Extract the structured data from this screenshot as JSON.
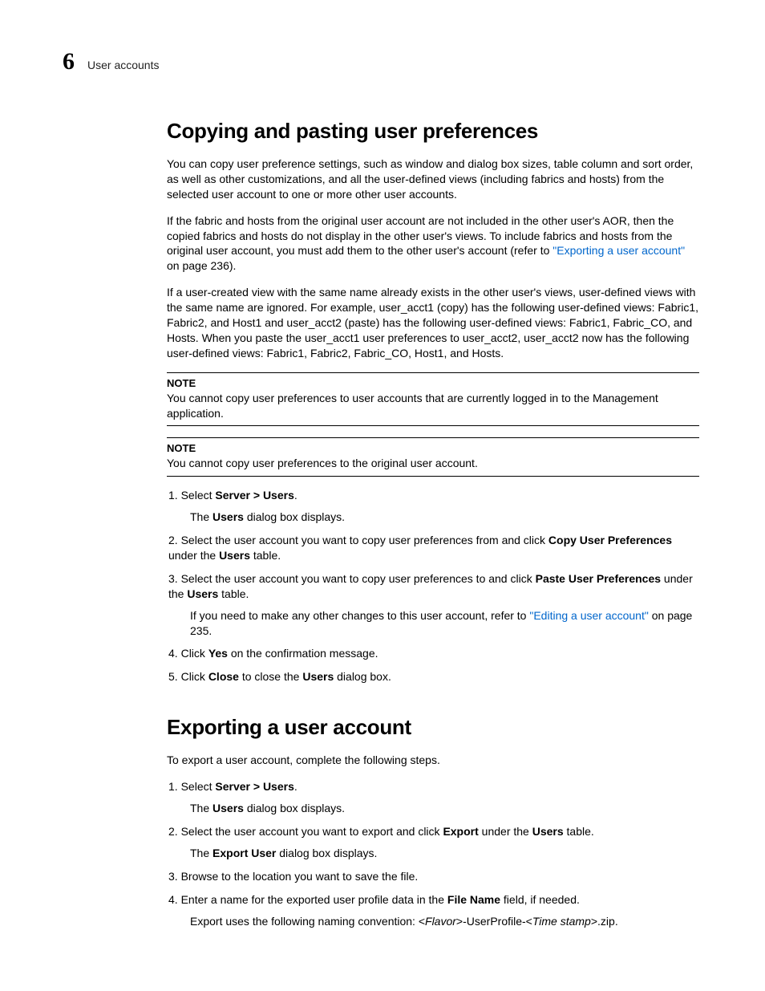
{
  "header": {
    "chapter_num": "6",
    "running_title": "User accounts"
  },
  "section1": {
    "title": "Copying and pasting user preferences",
    "p1": "You can copy user preference settings, such as window and dialog box sizes, table column and sort order, as well as other customizations, and all the user-defined views (including fabrics and hosts) from the selected user account to one or more other user accounts.",
    "p2a": "If the fabric and hosts from the original user account are not included in the other user's AOR, then the copied fabrics and hosts do not display in the other user's views. To include fabrics and hosts from the original user account, you must add them to the other user's account (refer to ",
    "p2link": "\"Exporting a user account\"",
    "p2b": " on page 236).",
    "p3": "If a user-created view with the same name already exists in the other user's views, user-defined views with the same name are ignored. For example, user_acct1 (copy) has the following user-defined views: Fabric1, Fabric2, and Host1 and user_acct2 (paste) has the following user-defined views: Fabric1, Fabric_CO, and Hosts. When you paste the user_acct1 user preferences to user_acct2, user_acct2 now has the following user-defined views: Fabric1, Fabric2, Fabric_CO, Host1, and Hosts.",
    "note1": {
      "label": "NOTE",
      "body": "You cannot copy user preferences to user accounts that are currently logged in to the Management application."
    },
    "note2": {
      "label": "NOTE",
      "body": "You cannot copy user preferences to the original user account."
    },
    "steps": {
      "s1": {
        "pre": "Select ",
        "bold": "Server > Users",
        "post": ".",
        "sub_pre": "The ",
        "sub_bold": "Users",
        "sub_post": " dialog box displays."
      },
      "s2": {
        "pre": "Select the user account you want to copy user preferences from and click ",
        "bold1": "Copy User Preferences",
        "mid": " under the ",
        "bold2": "Users",
        "post": " table."
      },
      "s3": {
        "pre": "Select the user account you want to copy user preferences to and click ",
        "bold1": "Paste User Preferences",
        "mid": " under the ",
        "bold2": "Users",
        "post": " table.",
        "sub_pre": "If you need to make any other changes to this user account, refer to ",
        "sub_link": "\"Editing a user account\"",
        "sub_post": " on page 235."
      },
      "s4": {
        "pre": "Click ",
        "bold": "Yes",
        "post": " on the confirmation message."
      },
      "s5": {
        "pre": "Click ",
        "bold1": "Close",
        "mid": " to close the ",
        "bold2": "Users",
        "post": " dialog box."
      }
    }
  },
  "section2": {
    "title": "Exporting a user account",
    "intro": "To export a user account, complete the following steps.",
    "steps": {
      "s1": {
        "pre": "Select ",
        "bold": "Server > Users",
        "post": ".",
        "sub_pre": "The ",
        "sub_bold": "Users",
        "sub_post": " dialog box displays."
      },
      "s2": {
        "pre": "Select the user account you want to export and click ",
        "bold1": "Export",
        "mid": " under the ",
        "bold2": "Users",
        "post": " table.",
        "sub_pre": "The ",
        "sub_bold": "Export User",
        "sub_post": " dialog box displays."
      },
      "s3": {
        "text": "Browse to the location you want to save the file."
      },
      "s4": {
        "pre": "Enter a name for the exported user profile data in the ",
        "bold": "File Name",
        "post": " field, if needed.",
        "sub_pre": "Export uses the following naming convention: <",
        "sub_i1": "Flavor",
        "sub_mid": ">-UserProfile-<",
        "sub_i2": "Time stamp",
        "sub_post": ">.zip."
      }
    }
  }
}
